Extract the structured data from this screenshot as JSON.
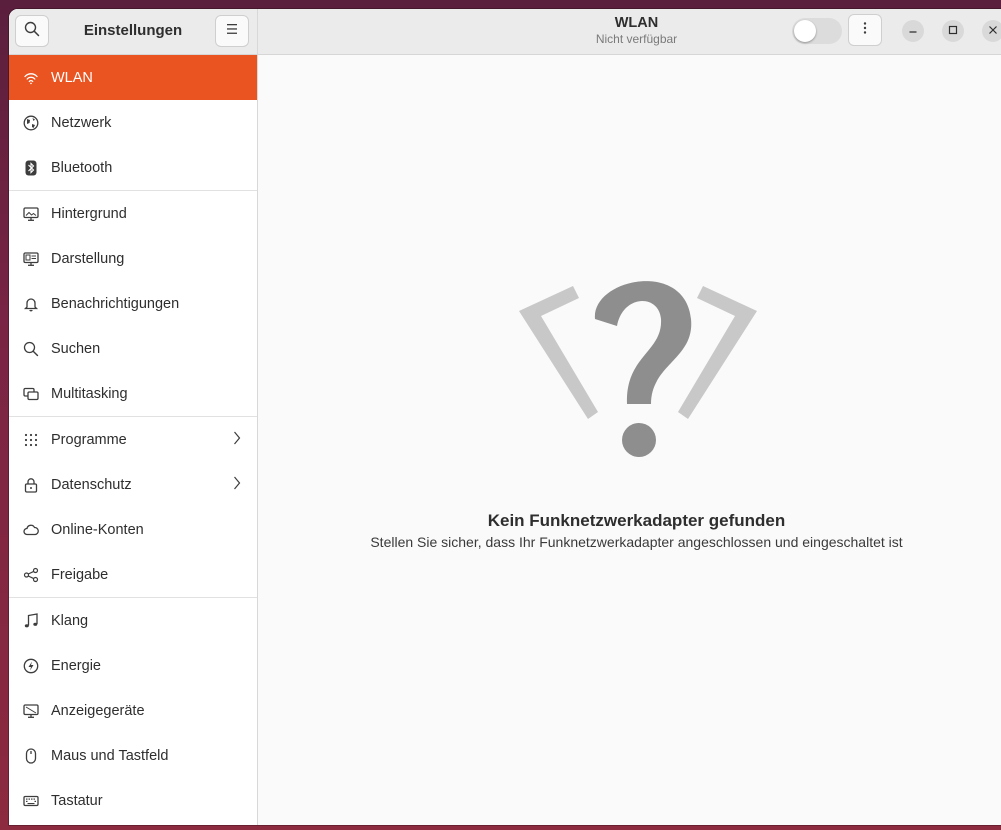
{
  "sidebar": {
    "title": "Einstellungen",
    "search_icon": "search-icon",
    "menu_icon": "hamburger-menu-icon",
    "groups": [
      [
        {
          "label": "WLAN",
          "icon": "wifi-icon",
          "active": true
        },
        {
          "label": "Netzwerk",
          "icon": "globe-icon"
        },
        {
          "label": "Bluetooth",
          "icon": "bluetooth-icon"
        }
      ],
      [
        {
          "label": "Hintergrund",
          "icon": "desktop-background-icon"
        },
        {
          "label": "Darstellung",
          "icon": "appearance-icon"
        },
        {
          "label": "Benachrichtigungen",
          "icon": "bell-icon"
        },
        {
          "label": "Suchen",
          "icon": "search-icon"
        },
        {
          "label": "Multitasking",
          "icon": "multitasking-icon"
        }
      ],
      [
        {
          "label": "Programme",
          "icon": "apps-grid-icon",
          "chevron": true
        },
        {
          "label": "Datenschutz",
          "icon": "lock-icon",
          "chevron": true
        },
        {
          "label": "Online-Konten",
          "icon": "cloud-icon"
        },
        {
          "label": "Freigabe",
          "icon": "share-icon"
        }
      ],
      [
        {
          "label": "Klang",
          "icon": "music-note-icon"
        },
        {
          "label": "Energie",
          "icon": "power-icon"
        },
        {
          "label": "Anzeigegeräte",
          "icon": "display-icon"
        },
        {
          "label": "Maus und Tastfeld",
          "icon": "mouse-icon"
        },
        {
          "label": "Tastatur",
          "icon": "keyboard-icon"
        }
      ]
    ]
  },
  "header": {
    "title": "WLAN",
    "subtitle": "Nicht verfügbar",
    "toggle_on": false
  },
  "main": {
    "empty_title": "Kein Funknetzwerkadapter gefunden",
    "empty_description": "Stellen Sie sicher, dass Ihr Funknetzwerkadapter angeschlossen und eingeschaltet ist"
  },
  "colors": {
    "accent": "#e95420",
    "icon": "#3d3d3d"
  }
}
